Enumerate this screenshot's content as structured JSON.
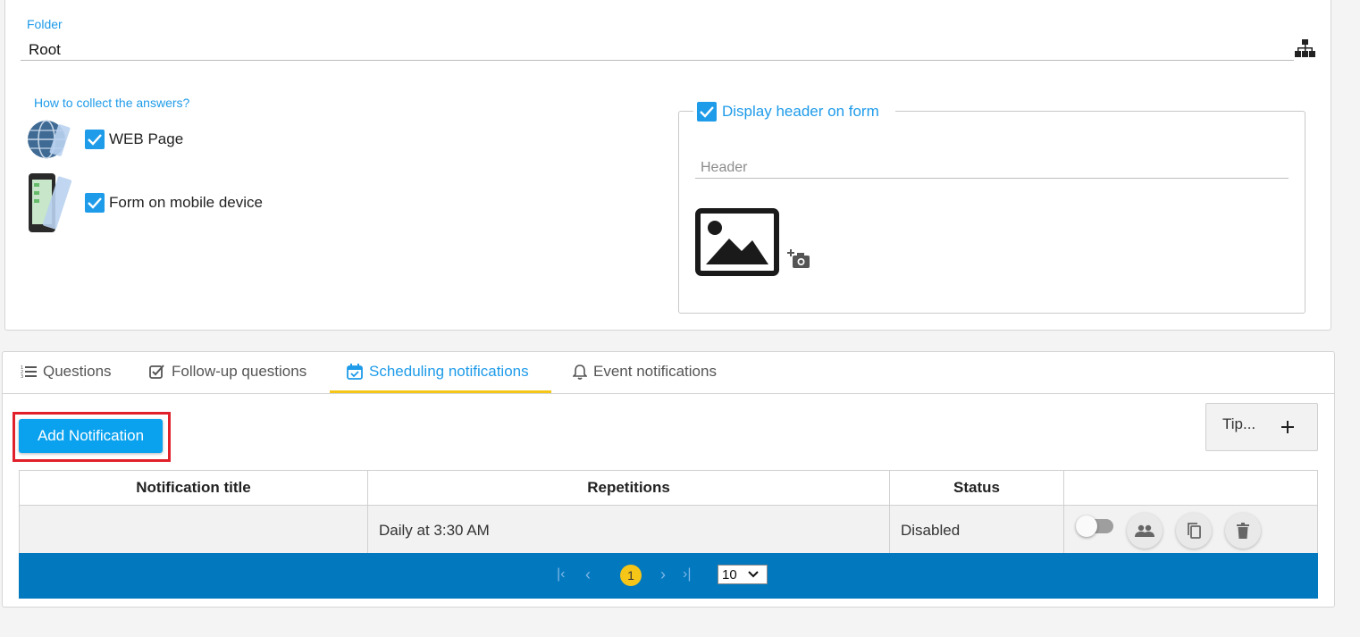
{
  "form": {
    "folder_label": "Folder",
    "folder_value": "Root",
    "collect_label": "How to collect the answers?",
    "options": [
      {
        "label": "WEB Page",
        "checked": true
      },
      {
        "label": "Form on mobile device",
        "checked": true
      }
    ],
    "display_header_label": "Display header on form",
    "display_header_checked": true,
    "header_placeholder": "Header"
  },
  "tabs": [
    {
      "label": "Questions",
      "icon": "list-numbered-icon",
      "active": false
    },
    {
      "label": "Follow-up questions",
      "icon": "checkbox-square-icon",
      "active": false
    },
    {
      "label": "Scheduling notifications",
      "icon": "calendar-check-icon",
      "active": true
    },
    {
      "label": "Event notifications",
      "icon": "bell-icon",
      "active": false
    }
  ],
  "toolbar": {
    "add_notification_label": "Add Notification",
    "tip_label": "Tip...",
    "tip_icon": "plus-icon"
  },
  "table": {
    "headers": [
      "Notification title",
      "Repetitions",
      "Status",
      ""
    ],
    "rows": [
      {
        "title": "",
        "repetitions": "Daily at 3:30 AM",
        "status": "Disabled",
        "enabled": false
      }
    ]
  },
  "pager": {
    "current_page": "1",
    "page_size": "10"
  },
  "colors": {
    "accent": "#1e9be9",
    "button": "#0aa2ef",
    "pager_bar": "#0278bf",
    "active_tab_underline": "#f5c518",
    "highlight_frame": "#e0202a"
  }
}
